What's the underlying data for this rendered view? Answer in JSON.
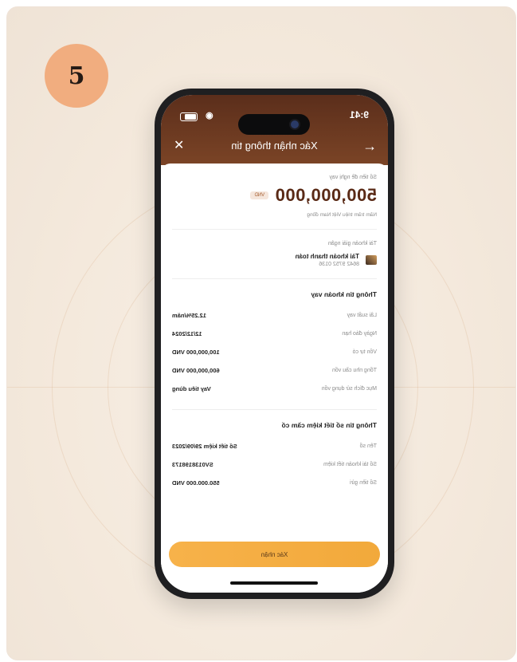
{
  "step": {
    "number": "5"
  },
  "status_bar": {
    "time": "9:41"
  },
  "nav": {
    "title": "Xác nhận thông tin",
    "back_icon": "arrow-left-icon",
    "close_icon": "close-icon"
  },
  "amount": {
    "label": "Số tiền đề nghị vay",
    "value": "500,000,000",
    "currency": "VND",
    "in_words": "Năm trăm triệu Việt Nam đồng"
  },
  "disbursement": {
    "label": "Tài khoản giải ngân",
    "account_name": "Tài khoản thanh toán",
    "account_number": "8642 9752 0136"
  },
  "loan_info": {
    "title": "Thông tin khoản vay",
    "rows": [
      {
        "label": "Lãi suất vay",
        "value": "12.25%/năm"
      },
      {
        "label": "Ngày đáo hạn",
        "value": "12/12/2024"
      },
      {
        "label": "Vốn tự có",
        "value": "100,000,000 VND"
      },
      {
        "label": "Tổng nhu cầu vốn",
        "value": "600,000,000 VND"
      },
      {
        "label": "Mục đích sử dụng vốn",
        "value": "Vay tiêu dùng"
      }
    ]
  },
  "savings_info": {
    "title": "Thông tin sổ tiết kiệm cầm cố",
    "rows": [
      {
        "label": "Tên sổ",
        "value": "Sổ tiết kiệm 29/09/2023"
      },
      {
        "label": "Số tài khoản tiết kiệm",
        "value": "SV0138198173"
      },
      {
        "label": "Số tiền gửi",
        "value": "550.000.000 VND"
      }
    ]
  },
  "confirm_button": {
    "label": "Xác nhận"
  },
  "colors": {
    "header": "#6b3a20",
    "accent": "#f2a93b",
    "step_badge": "#f1ad7f"
  }
}
